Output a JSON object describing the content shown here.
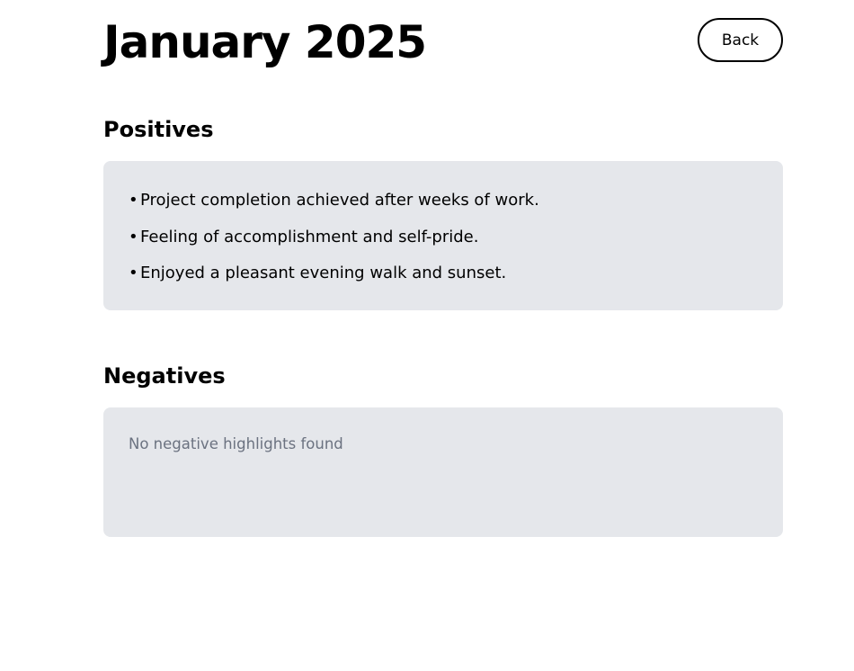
{
  "header": {
    "title": "January 2025",
    "back_label": "Back"
  },
  "positives": {
    "heading": "Positives",
    "bullet": "•",
    "items": [
      {
        "text": "Project completion achieved after weeks of work."
      },
      {
        "text": "Feeling of accomplishment and self-pride."
      },
      {
        "text": "Enjoyed a pleasant evening walk and sunset."
      }
    ]
  },
  "negatives": {
    "heading": "Negatives",
    "empty_text": "No negative highlights found"
  },
  "colors": {
    "background": "#ffffff",
    "card_background": "#e5e7eb",
    "muted_text": "#6b7280",
    "text": "#000000"
  }
}
